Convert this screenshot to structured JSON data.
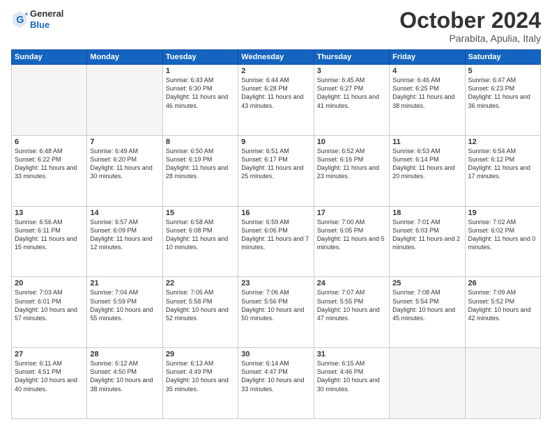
{
  "header": {
    "logo": {
      "general": "General",
      "blue": "Blue"
    },
    "title": "October 2024",
    "subtitle": "Parabita, Apulia, Italy"
  },
  "weekdays": [
    "Sunday",
    "Monday",
    "Tuesday",
    "Wednesday",
    "Thursday",
    "Friday",
    "Saturday"
  ],
  "weeks": [
    [
      {
        "day": "",
        "sunrise": "",
        "sunset": "",
        "daylight": "",
        "empty": true
      },
      {
        "day": "",
        "sunrise": "",
        "sunset": "",
        "daylight": "",
        "empty": true
      },
      {
        "day": "1",
        "sunrise": "Sunrise: 6:43 AM",
        "sunset": "Sunset: 6:30 PM",
        "daylight": "Daylight: 11 hours and 46 minutes.",
        "empty": false
      },
      {
        "day": "2",
        "sunrise": "Sunrise: 6:44 AM",
        "sunset": "Sunset: 6:28 PM",
        "daylight": "Daylight: 11 hours and 43 minutes.",
        "empty": false
      },
      {
        "day": "3",
        "sunrise": "Sunrise: 6:45 AM",
        "sunset": "Sunset: 6:27 PM",
        "daylight": "Daylight: 11 hours and 41 minutes.",
        "empty": false
      },
      {
        "day": "4",
        "sunrise": "Sunrise: 6:46 AM",
        "sunset": "Sunset: 6:25 PM",
        "daylight": "Daylight: 11 hours and 38 minutes.",
        "empty": false
      },
      {
        "day": "5",
        "sunrise": "Sunrise: 6:47 AM",
        "sunset": "Sunset: 6:23 PM",
        "daylight": "Daylight: 11 hours and 36 minutes.",
        "empty": false
      }
    ],
    [
      {
        "day": "6",
        "sunrise": "Sunrise: 6:48 AM",
        "sunset": "Sunset: 6:22 PM",
        "daylight": "Daylight: 11 hours and 33 minutes.",
        "empty": false
      },
      {
        "day": "7",
        "sunrise": "Sunrise: 6:49 AM",
        "sunset": "Sunset: 6:20 PM",
        "daylight": "Daylight: 11 hours and 30 minutes.",
        "empty": false
      },
      {
        "day": "8",
        "sunrise": "Sunrise: 6:50 AM",
        "sunset": "Sunset: 6:19 PM",
        "daylight": "Daylight: 11 hours and 28 minutes.",
        "empty": false
      },
      {
        "day": "9",
        "sunrise": "Sunrise: 6:51 AM",
        "sunset": "Sunset: 6:17 PM",
        "daylight": "Daylight: 11 hours and 25 minutes.",
        "empty": false
      },
      {
        "day": "10",
        "sunrise": "Sunrise: 6:52 AM",
        "sunset": "Sunset: 6:16 PM",
        "daylight": "Daylight: 11 hours and 23 minutes.",
        "empty": false
      },
      {
        "day": "11",
        "sunrise": "Sunrise: 6:53 AM",
        "sunset": "Sunset: 6:14 PM",
        "daylight": "Daylight: 11 hours and 20 minutes.",
        "empty": false
      },
      {
        "day": "12",
        "sunrise": "Sunrise: 6:54 AM",
        "sunset": "Sunset: 6:12 PM",
        "daylight": "Daylight: 11 hours and 17 minutes.",
        "empty": false
      }
    ],
    [
      {
        "day": "13",
        "sunrise": "Sunrise: 6:56 AM",
        "sunset": "Sunset: 6:11 PM",
        "daylight": "Daylight: 11 hours and 15 minutes.",
        "empty": false
      },
      {
        "day": "14",
        "sunrise": "Sunrise: 6:57 AM",
        "sunset": "Sunset: 6:09 PM",
        "daylight": "Daylight: 11 hours and 12 minutes.",
        "empty": false
      },
      {
        "day": "15",
        "sunrise": "Sunrise: 6:58 AM",
        "sunset": "Sunset: 6:08 PM",
        "daylight": "Daylight: 11 hours and 10 minutes.",
        "empty": false
      },
      {
        "day": "16",
        "sunrise": "Sunrise: 6:59 AM",
        "sunset": "Sunset: 6:06 PM",
        "daylight": "Daylight: 11 hours and 7 minutes.",
        "empty": false
      },
      {
        "day": "17",
        "sunrise": "Sunrise: 7:00 AM",
        "sunset": "Sunset: 6:05 PM",
        "daylight": "Daylight: 11 hours and 5 minutes.",
        "empty": false
      },
      {
        "day": "18",
        "sunrise": "Sunrise: 7:01 AM",
        "sunset": "Sunset: 6:03 PM",
        "daylight": "Daylight: 11 hours and 2 minutes.",
        "empty": false
      },
      {
        "day": "19",
        "sunrise": "Sunrise: 7:02 AM",
        "sunset": "Sunset: 6:02 PM",
        "daylight": "Daylight: 11 hours and 0 minutes.",
        "empty": false
      }
    ],
    [
      {
        "day": "20",
        "sunrise": "Sunrise: 7:03 AM",
        "sunset": "Sunset: 6:01 PM",
        "daylight": "Daylight: 10 hours and 57 minutes.",
        "empty": false
      },
      {
        "day": "21",
        "sunrise": "Sunrise: 7:04 AM",
        "sunset": "Sunset: 5:59 PM",
        "daylight": "Daylight: 10 hours and 55 minutes.",
        "empty": false
      },
      {
        "day": "22",
        "sunrise": "Sunrise: 7:05 AM",
        "sunset": "Sunset: 5:58 PM",
        "daylight": "Daylight: 10 hours and 52 minutes.",
        "empty": false
      },
      {
        "day": "23",
        "sunrise": "Sunrise: 7:06 AM",
        "sunset": "Sunset: 5:56 PM",
        "daylight": "Daylight: 10 hours and 50 minutes.",
        "empty": false
      },
      {
        "day": "24",
        "sunrise": "Sunrise: 7:07 AM",
        "sunset": "Sunset: 5:55 PM",
        "daylight": "Daylight: 10 hours and 47 minutes.",
        "empty": false
      },
      {
        "day": "25",
        "sunrise": "Sunrise: 7:08 AM",
        "sunset": "Sunset: 5:54 PM",
        "daylight": "Daylight: 10 hours and 45 minutes.",
        "empty": false
      },
      {
        "day": "26",
        "sunrise": "Sunrise: 7:09 AM",
        "sunset": "Sunset: 5:52 PM",
        "daylight": "Daylight: 10 hours and 42 minutes.",
        "empty": false
      }
    ],
    [
      {
        "day": "27",
        "sunrise": "Sunrise: 6:11 AM",
        "sunset": "Sunset: 4:51 PM",
        "daylight": "Daylight: 10 hours and 40 minutes.",
        "empty": false
      },
      {
        "day": "28",
        "sunrise": "Sunrise: 6:12 AM",
        "sunset": "Sunset: 4:50 PM",
        "daylight": "Daylight: 10 hours and 38 minutes.",
        "empty": false
      },
      {
        "day": "29",
        "sunrise": "Sunrise: 6:13 AM",
        "sunset": "Sunset: 4:49 PM",
        "daylight": "Daylight: 10 hours and 35 minutes.",
        "empty": false
      },
      {
        "day": "30",
        "sunrise": "Sunrise: 6:14 AM",
        "sunset": "Sunset: 4:47 PM",
        "daylight": "Daylight: 10 hours and 33 minutes.",
        "empty": false
      },
      {
        "day": "31",
        "sunrise": "Sunrise: 6:15 AM",
        "sunset": "Sunset: 4:46 PM",
        "daylight": "Daylight: 10 hours and 30 minutes.",
        "empty": false
      },
      {
        "day": "",
        "sunrise": "",
        "sunset": "",
        "daylight": "",
        "empty": true
      },
      {
        "day": "",
        "sunrise": "",
        "sunset": "",
        "daylight": "",
        "empty": true
      }
    ]
  ]
}
